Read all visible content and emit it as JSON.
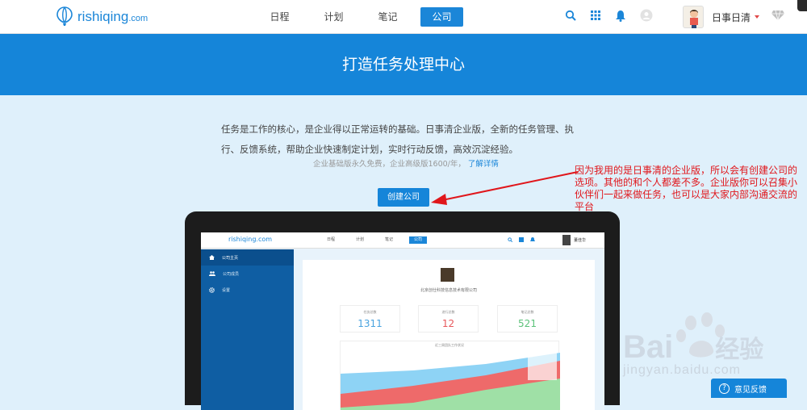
{
  "header": {
    "brand": "rishiqing",
    "brand_domain": ".com",
    "tabs": [
      "日程",
      "计划",
      "笔记",
      "公司"
    ],
    "active_tab": "公司",
    "user_name": "日事日清"
  },
  "hero": {
    "title": "打造任务处理中心"
  },
  "intro": {
    "text": "任务是工作的核心，是企业得以正常运转的基础。日事清企业版，全新的任务管理、执行、反馈系统，帮助企业快速制定计划，实时行动反馈，高效沉淀经验。",
    "pricing": "企业基础版永久免费，企业高级版1600/年，",
    "details_link": "了解详情"
  },
  "create_button": "创建公司",
  "annotation": "因为我用的是日事清的企业版，所以会有创建公司的选项。其他的和个人都差不多。企业版你可以召集小伙伴们一起来做任务，也可以是大家内部沟通交流的平台",
  "laptop_screen": {
    "brand": "rishiqing",
    "brand_domain": ".com",
    "tabs": [
      "日程",
      "计划",
      "笔记",
      "公司"
    ],
    "user_name": "董佳华",
    "sidebar": [
      "公司主页",
      "公司成员",
      "设置"
    ],
    "company_name": "北京创仕科技信息技术有限公司",
    "stats": [
      {
        "label": "任务总数",
        "value": "1311",
        "color": "#4aa3df"
      },
      {
        "label": "进行总数",
        "value": "12",
        "color": "#e8585c"
      },
      {
        "label": "笔记总数",
        "value": "521",
        "color": "#5cc27a"
      }
    ],
    "chart_title": "近三周团队工作状况"
  },
  "watermark": {
    "brand": "Bai",
    "brand_cn": "经验",
    "url": "jingyan.baidu.com"
  },
  "feedback": "意见反馈",
  "colors": {
    "primary": "#1585d9",
    "annotation": "#e0161b"
  }
}
